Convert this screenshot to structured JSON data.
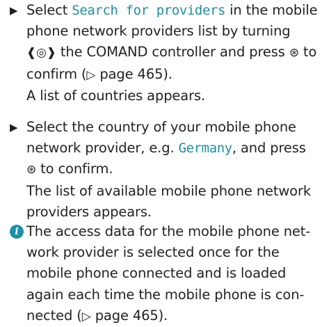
{
  "step1": {
    "marker": "▶",
    "before": "Select ",
    "highlight": "Search for providers",
    "text_a": " in the mobile phone network providers list by turning ",
    "controller_symbol": "❰◎❱",
    "text_b": " the COMAND controller and press ",
    "confirm_symbol": "⊛",
    "text_c": " to confirm (",
    "ref_arrow": "▷",
    "ref_page": " page 465).",
    "result": "A list of countries appears."
  },
  "step2": {
    "marker": "▶",
    "before": "Select the country of your mobile phone network provider, e.g. ",
    "highlight": "Germany",
    "text_a": ", and press ",
    "confirm_symbol": "⊛",
    "text_b": " to confirm.",
    "result": "The list of available mobile phone network providers appears."
  },
  "note": {
    "icon": "info-icon",
    "text_a": "The access data for the mobile phone net-work provider is selected once for the mobile phone connected and is loaded again each time the mobile phone is con-nected (",
    "ref_arrow": "▷",
    "ref_page": " page 465)."
  },
  "colors": {
    "accent": "#1e8fa6",
    "text": "#222222"
  }
}
